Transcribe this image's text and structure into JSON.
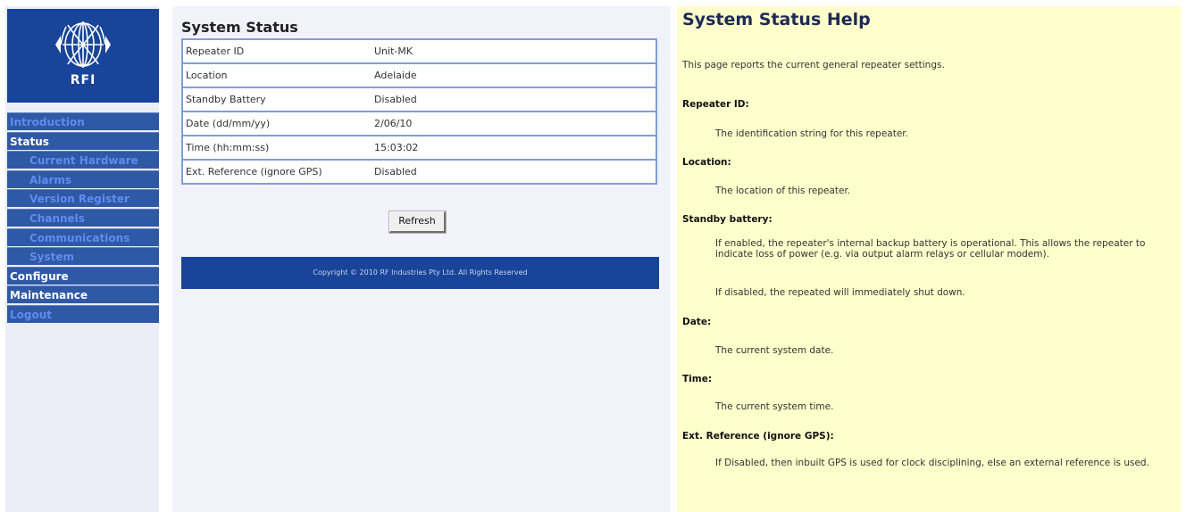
{
  "sidebar": {
    "logo_text": "RFI",
    "nav": [
      {
        "label": "Introduction",
        "level": "top",
        "tone": "dim"
      },
      {
        "label": "Status",
        "level": "top",
        "tone": "bright"
      },
      {
        "label": "Current Hardware",
        "level": "sub",
        "tone": "dim"
      },
      {
        "label": "Alarms",
        "level": "sub",
        "tone": "dim"
      },
      {
        "label": "Version Register",
        "level": "sub",
        "tone": "dim"
      },
      {
        "label": "Channels",
        "level": "sub",
        "tone": "dim"
      },
      {
        "label": "Communications",
        "level": "sub",
        "tone": "dim"
      },
      {
        "label": "System",
        "level": "sub",
        "tone": "dim"
      },
      {
        "label": "Configure",
        "level": "top",
        "tone": "bright"
      },
      {
        "label": "Maintenance",
        "level": "top",
        "tone": "bright"
      },
      {
        "label": "Logout",
        "level": "top",
        "tone": "dim"
      }
    ]
  },
  "main": {
    "title": "System Status",
    "rows": [
      {
        "key": "Repeater ID",
        "value": "Unit-MK"
      },
      {
        "key": "Location",
        "value": "Adelaide"
      },
      {
        "key": "Standby Battery",
        "value": "Disabled"
      },
      {
        "key": "Date (dd/mm/yy)",
        "value": "2/06/10"
      },
      {
        "key": "Time (hh:mm:ss)",
        "value": "15:03:02"
      },
      {
        "key": "Ext. Reference (ignore GPS)",
        "value": "Disabled"
      }
    ],
    "refresh_label": "Refresh",
    "footer": "Copyright © 2010 RF Industries Pty Ltd. All Rights Reserved"
  },
  "help": {
    "title": "System Status Help",
    "intro": "This page reports the current general repeater settings.",
    "sections": {
      "repeater_id": {
        "heading": "Repeater ID:",
        "text": "The identification string for this repeater."
      },
      "location": {
        "heading": "Location:",
        "text": "The location of this repeater."
      },
      "standby": {
        "heading": "Standby battery:",
        "text": "If enabled, the repeater's internal backup battery is operational. This allows the repeater to indicate loss of power (e.g. via output alarm relays or cellular modem).",
        "text2": "If disabled, the repeated will immediately shut down."
      },
      "date": {
        "heading": "Date:",
        "text": "The current system date."
      },
      "time": {
        "heading": "Time:",
        "text": "The current system time."
      },
      "ext_ref": {
        "heading": "Ext. Reference (ignore GPS):",
        "text": "If Disabled, then inbuilt GPS is used for clock disciplining, else an external reference is used."
      }
    }
  },
  "colors": {
    "nav_bg": "#2f58a5",
    "brand_blue": "#18449a",
    "help_bg": "#ffffcc",
    "table_border": "#7f9fd6"
  }
}
